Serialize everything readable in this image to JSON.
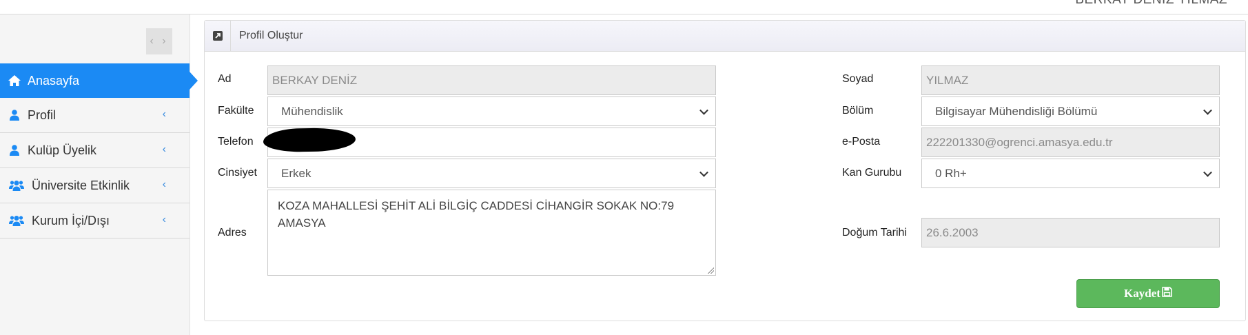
{
  "header": {
    "user_name": "BERKAY DENİZ YILMAZ"
  },
  "sidebar": {
    "toggle": "‹ ›",
    "items": [
      {
        "label": "Anasayfa",
        "icon": "home-icon",
        "active": true
      },
      {
        "label": "Profil",
        "icon": "user-icon",
        "chevron": "‹"
      },
      {
        "label": "Kulüp Üyelik",
        "icon": "user-icon",
        "chevron": "‹"
      },
      {
        "label": "Üniversite Etkinlik",
        "icon": "users-icon",
        "chevron": "‹"
      },
      {
        "label": "Kurum İçi/Dışı",
        "icon": "users-icon",
        "chevron": "‹"
      }
    ]
  },
  "panel": {
    "title": "Profil Oluştur",
    "icon": "external-link-icon"
  },
  "form": {
    "ad": {
      "label": "Ad",
      "value": "BERKAY DENİZ"
    },
    "soyad": {
      "label": "Soyad",
      "value": "YILMAZ"
    },
    "fakulte": {
      "label": "Fakülte",
      "value": "Mühendislik"
    },
    "bolum": {
      "label": "Bölüm",
      "value": "Bilgisayar Mühendisliği Bölümü"
    },
    "telefon": {
      "label": "Telefon",
      "value": ""
    },
    "eposta": {
      "label": "e-Posta",
      "value": "222201330@ogrenci.amasya.edu.tr"
    },
    "cinsiyet": {
      "label": "Cinsiyet",
      "value": "Erkek"
    },
    "kan_grubu": {
      "label": "Kan Gurubu",
      "value": "0 Rh+"
    },
    "adres": {
      "label": "Adres",
      "value": "KOZA MAHALLESİ ŞEHİT ALİ BİLGİÇ CADDESİ CİHANGİR SOKAK NO:79 AMASYA"
    },
    "dogum_tarihi": {
      "label": "Doğum Tarihi",
      "value": "26.6.2003"
    }
  },
  "actions": {
    "save_label": "Kaydet",
    "save_icon": "floppy-disk-icon"
  },
  "colors": {
    "accent": "#1b8af4",
    "success": "#5cb85c",
    "readonly_bg": "#ececec"
  }
}
